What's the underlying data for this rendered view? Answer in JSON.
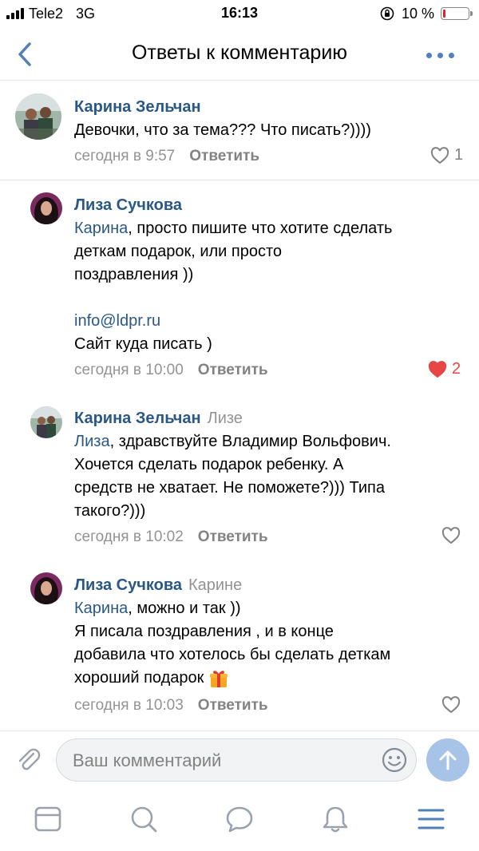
{
  "status_bar": {
    "carrier": "Tele2",
    "network": "3G",
    "time": "16:13",
    "battery": "10 %",
    "battery_level": 0.1
  },
  "header": {
    "title": "Ответы к комментарию"
  },
  "comments": [
    {
      "author": "Карина Зельчан",
      "reply_to": "",
      "lines": [
        "Девочки, что за тема??? Что писать?))))"
      ],
      "time": "сегодня в 9:57",
      "reply_label": "Ответить",
      "likes": "1",
      "liked": false
    },
    {
      "author": "Лиза Сучкова",
      "reply_to": "",
      "mention": "Карина",
      "lines": [
        ", просто пишите что хотите сделать",
        "деткам подарок, или просто",
        "поздравления ))",
        "",
        "info@ldpr.ru",
        "Сайт куда писать )"
      ],
      "time": "сегодня в 10:00",
      "reply_label": "Ответить",
      "likes": "2",
      "liked": true
    },
    {
      "author": "Карина Зельчан",
      "reply_to": "Лизе",
      "mention": "Лиза",
      "lines": [
        ", здравствуйте Владимир Вольфович.",
        "Хочется сделать подарок ребенку. А",
        "средств не хватает. Не поможете?))) Типа",
        "такого?)))"
      ],
      "time": "сегодня в 10:02",
      "reply_label": "Ответить",
      "likes": "",
      "liked": false
    },
    {
      "author": "Лиза Сучкова",
      "reply_to": "Карине",
      "mention": "Карина",
      "lines": [
        ", можно и так ))",
        "Я писала поздравления , и в конце",
        "добавила что хотелось бы сделать деткам",
        "хороший подарок"
      ],
      "time": "сегодня в 10:03",
      "reply_label": "Ответить",
      "likes": "",
      "liked": false
    }
  ],
  "input": {
    "placeholder": "Ваш комментарий"
  },
  "colors": {
    "accent": "#5181b8",
    "author": "#2a5885",
    "meta": "#939393",
    "like_active": "#e64646",
    "send_button": "#a7c4e8"
  },
  "tabs": [
    "news-icon",
    "search-icon",
    "messages-icon",
    "notifications-icon",
    "menu-icon"
  ]
}
